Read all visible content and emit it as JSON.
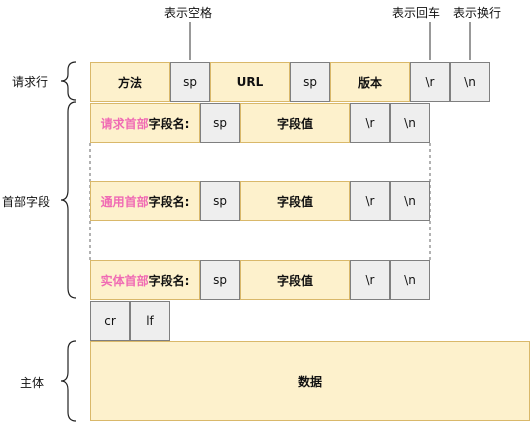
{
  "annotations": {
    "space": "表示空格",
    "cr": "表示回车",
    "lf": "表示换行"
  },
  "sections": {
    "request_line": "请求行",
    "headers": "首部字段",
    "body": "主体"
  },
  "request_line": {
    "method": "方法",
    "sp": "sp",
    "url": "URL",
    "version": "版本",
    "cr": "\\r",
    "lf": "\\n"
  },
  "header_rows": [
    {
      "prefix": "请求首部",
      "name": "字段名:",
      "sp": "sp",
      "value": "字段值",
      "cr": "\\r",
      "lf": "\\n"
    },
    {
      "prefix": "通用首部",
      "name": "字段名:",
      "sp": "sp",
      "value": "字段值",
      "cr": "\\r",
      "lf": "\\n"
    },
    {
      "prefix": "实体首部",
      "name": "字段名:",
      "sp": "sp",
      "value": "字段值",
      "cr": "\\r",
      "lf": "\\n"
    }
  ],
  "blank_line": {
    "cr": "cr",
    "lf": "lf"
  },
  "body": {
    "label": "数据"
  },
  "colors": {
    "field": "#fdf1cc",
    "control": "#eeeeee",
    "prefix_text": "#f06bb4"
  }
}
